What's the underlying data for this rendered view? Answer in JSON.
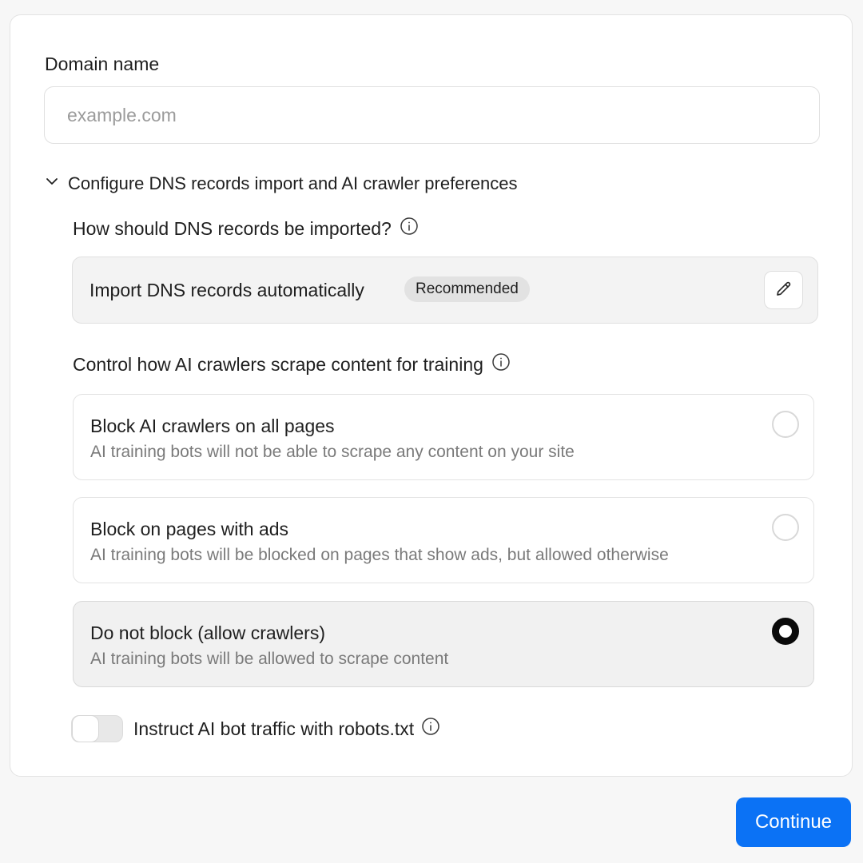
{
  "domain": {
    "label": "Domain name",
    "placeholder": "example.com",
    "value": ""
  },
  "disclosure": {
    "label": "Configure DNS records import and AI crawler preferences",
    "expanded": true
  },
  "dns": {
    "question": "How should DNS records be imported?",
    "selected_method": "Import DNS records automatically",
    "badge": "Recommended"
  },
  "ai_crawlers": {
    "question": "Control how AI crawlers scrape content for training",
    "options": [
      {
        "title": "Block AI crawlers on all pages",
        "description": "AI training bots will not be able to scrape any content on your site",
        "selected": false
      },
      {
        "title": "Block on pages with ads",
        "description": "AI training bots will be blocked on pages that show ads, but allowed otherwise",
        "selected": false
      },
      {
        "title": "Do not block (allow crawlers)",
        "description": "AI training bots will be allowed to scrape content",
        "selected": true
      }
    ]
  },
  "robots_toggle": {
    "label": "Instruct AI bot traffic with robots.txt",
    "enabled": false
  },
  "actions": {
    "continue_label": "Continue"
  },
  "colors": {
    "accent": "#0b72f5",
    "selected_option_bg": "#f1f1f1",
    "muted_text": "#7a7a7a"
  }
}
